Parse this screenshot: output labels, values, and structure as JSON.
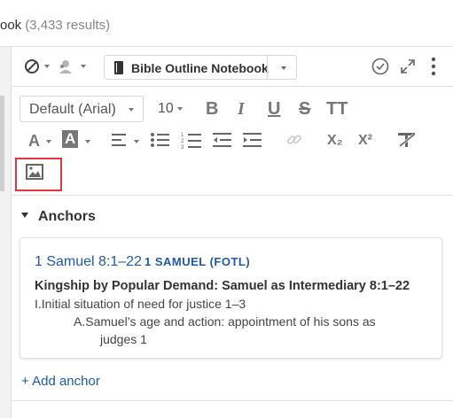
{
  "header": {
    "title_tail": "ook",
    "results": "(3,433 results)"
  },
  "toolbar": {
    "notebook_name": "Bible Outline Notebook",
    "icons": [
      "block-icon",
      "person-icon",
      "notebook-icon",
      "check-circle-icon",
      "expand-icon",
      "more-vert-icon"
    ]
  },
  "format": {
    "font": "Default (Arial)",
    "size": "10",
    "bold": "B",
    "italic": "I",
    "underline": "U",
    "strike": "S",
    "text_size": "TT",
    "font_color": "A",
    "highlight": "A",
    "subscript": "X₂",
    "superscript": "X²"
  },
  "anchors": {
    "title": "Anchors",
    "reference": "1 Samuel 8:1–22",
    "book_label": "1 SAMUEL (FOTL)",
    "heading": "Kingship by Popular Demand: Samuel as Intermediary 8:1–22",
    "line1": "I.Initial situation of need for justice 1–3",
    "line2": "A.Samuel’s age and action: appointment of his sons as",
    "line3": "judges 1",
    "add_label": "+ Add anchor"
  },
  "accent": "#1f5aa8",
  "highlight_color": "#e0383e"
}
